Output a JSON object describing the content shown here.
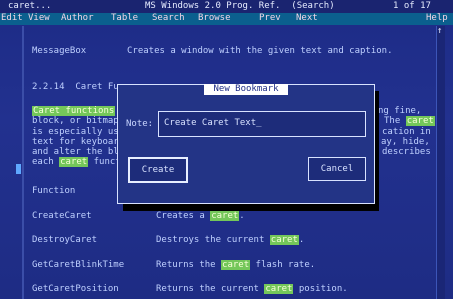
{
  "titlebar": {
    "left": "caret...",
    "center": "MS Windows 2.0 Prog. Ref.  (Search)",
    "right": "1 of 17"
  },
  "menu": [
    "Edit",
    "View",
    "Author",
    "Table",
    "Search",
    "Browse",
    "Prev",
    "Next",
    "Help"
  ],
  "content": {
    "messagebox_name": "MessageBox",
    "messagebox_desc": "Creates a window with the given text and caption.",
    "section": "2.2.14  Caret Fu",
    "para": {
      "line1_a": "Caret functions",
      "line1_b": "ng fine,",
      "line2_a": "block, or bitmap",
      "line2_b": "The",
      "line2_hl": "caret",
      "line3_a": "is especially us",
      "line3_b": "cation in",
      "line4_a": "text for keyboar",
      "line4_b": "ay, hide,",
      "line5_a": "and alter the bl",
      "line5_b": "describes",
      "line6_a": "each",
      "line6_hl": "caret",
      "line6_b": "funct"
    },
    "function_header": "Function",
    "rows": [
      {
        "name": "CreateCaret",
        "pre": "Creates a",
        "hl": "caret",
        "post": "."
      },
      {
        "name": "DestroyCaret",
        "pre": "Destroys the current",
        "hl": "caret",
        "post": "."
      },
      {
        "name": "GetCaretBlinkTime",
        "pre": "Returns the",
        "hl": "caret",
        "post": "flash rate."
      },
      {
        "name": "GetCaretPosition",
        "pre": "Returns the current",
        "hl": "caret",
        "post": "position."
      }
    ]
  },
  "dialog": {
    "title": "New Bookmark",
    "note_label": "Note:",
    "note_value": "Create Caret Text_",
    "create": "Create",
    "cancel": "Cancel"
  }
}
